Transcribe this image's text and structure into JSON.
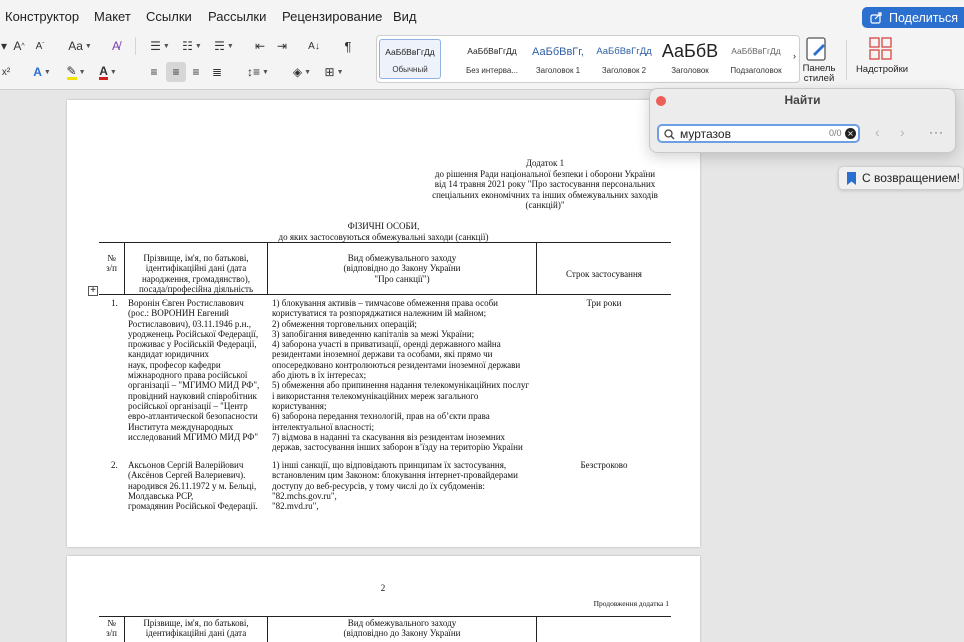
{
  "menu": [
    "Конструктор",
    "Макет",
    "Ссылки",
    "Рассылки",
    "Рецензирование",
    "Вид"
  ],
  "share_label": "Поделиться",
  "ribbon": {
    "styles": [
      {
        "preview": "АаБбВвГгДд",
        "name": "Обычный"
      },
      {
        "preview": "АаБбВвГгДд",
        "name": "Без интерва..."
      },
      {
        "preview": "АаБбВвГг,",
        "name": "Заголовок 1"
      },
      {
        "preview": "АаБбВвГгДд",
        "name": "Заголовок 2"
      },
      {
        "preview": "АаБбВ",
        "name": "Заголовок"
      },
      {
        "preview": "АаБбВвГгДд",
        "name": "Подзаголовок"
      }
    ],
    "styles_pane_label": "Панель стилей",
    "addins_label": "Надстройки",
    "accent": "#2b6fcf"
  },
  "find": {
    "title": "Найти",
    "query": "муртазов",
    "count": "0/0"
  },
  "welcome_label": "С возвращением!",
  "page1": {
    "header_lines": [
      "Додаток 1",
      "до рішення Ради національної безпеки і оборони України",
      "від 14 травня 2021 року \"Про застосування  персональних",
      "спеціальних економічних та інших обмежувальних заходів",
      "(санкцій)\""
    ],
    "title_lines": [
      "ФІЗИЧНІ ОСОБИ,",
      "до яких застосовуються обмежувальні заходи (санкції)"
    ],
    "columns": [
      "№\nз/п",
      "Прізвище, ім'я, по батькові,\nідентифікаційні дані (дата\nнародження, громадянство),\nпосада/професійна діяльність",
      "Вид обмежувального заходу\n(відповідно до Закону України\n\"Про санкції\")",
      "Строк застосування"
    ],
    "rows": [
      {
        "num": "1.",
        "person": "Воронін Євген Ростиславович\n(рос.: ВОРОНИН Евгений\nРостиславович), 03.11.1946 р.н.,\nуродженець Російської Федерації,\nпроживає у Російській Федерації,\nкандидат юридичних\nнаук, професор кафедри\nміжнародного права російської\nорганізації – \"МГИМО МИД РФ\",\nпровідний науковий співробітник\nросійської організації – \"Центр\nевро-атлантической безопасности\nИнститута международных\nисследований МГИМО МИД РФ\"",
        "measures": "1) блокування активів – тимчасове обмеження права особи\nкористуватися та розпоряджатися належним їй майном;\n2) обмеження торговельних операцій;\n3) запобігання виведенню капіталів за межі України;\n4) заборона участі в приватизації, оренді державного майна\nрезидентами іноземної держави та особами, які прямо чи\nопосередковано контролюються резидентами іноземної держави\nабо діють в їх інтересах;\n5) обмеження або припинення надання телекомунікаційних послуг\nі використання телекомунікаційних мереж загального\nкористування;\n6) заборона передання технологій, прав на об’єкти права\nінтелектуальної власності;\n7) відмова в наданні та скасування віз резидентам іноземних\nдержав, застосування інших заборон в’їзду на територію України",
        "term": "Три роки"
      },
      {
        "num": "2.",
        "person": "Аксьонов Сергій Валерійович\n(Аксёнов Сергей Валериевич).\nнародився 26.11.1972 у м.  Бельці,\nМолдавська РСР,\nгромадянин Російської Федерації.",
        "measures": "1) інші санкції, що відповідають принципам їх застосування,\nвстановленим цим Законом: блокування інтернет-провайдерами\nдоступу до веб-ресурсів, у тому числі до їх субдоменів:\n\"82.mchs.gov.ru\",\n\"82.mvd.ru\",",
        "term": "Безстроково"
      }
    ]
  },
  "page2": {
    "page_number": "2",
    "continuation": "Продовження додатка 1",
    "col_no": "№\nз/п",
    "col_person": "Прізвище, ім'я, по батькові,\nідентифікаційні дані (дата",
    "col_measure": "Вид обмежувального заходу\n(відповідно до Закону України"
  }
}
